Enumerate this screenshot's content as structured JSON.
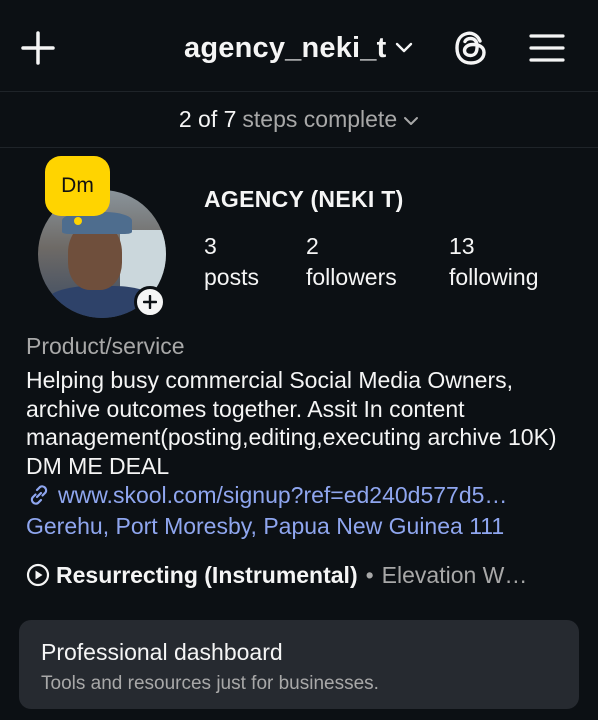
{
  "header": {
    "username": "agency_neki_t"
  },
  "steps": {
    "progress": "2 of 7",
    "label": "steps complete"
  },
  "profile": {
    "dm_bubble": "Dm",
    "display_name": "AGENCY (NEKI T)",
    "stats": [
      {
        "value": "3",
        "label": "posts"
      },
      {
        "value": "2",
        "label": "followers"
      },
      {
        "value": "13",
        "label": "following"
      }
    ],
    "category": "Product/service",
    "bio": "Helping busy commercial Social  Media Owners, archive outcomes together. Assit In content management(posting,editing,executing archive 10K) DM ME DEAL",
    "link": "www.skool.com/signup?ref=ed240d577d5…",
    "address": "Gerehu, Port Moresby, Papua New Guinea 111"
  },
  "music": {
    "song": "Resurrecting (Instrumental)",
    "separator": "•",
    "artist": "Elevation W…"
  },
  "dashboard": {
    "title": "Professional dashboard",
    "subtitle": "Tools and resources just for businesses."
  },
  "colors": {
    "background": "#0c1014",
    "link": "#8fa6ef",
    "muted": "#a8a8a8",
    "dm_bubble": "#ffd400",
    "card": "#262a30"
  },
  "icons": [
    "plus-icon",
    "chevron-down-icon",
    "threads-icon",
    "hamburger-menu-icon",
    "add-story-plus-icon",
    "link-icon",
    "play-circle-icon"
  ]
}
